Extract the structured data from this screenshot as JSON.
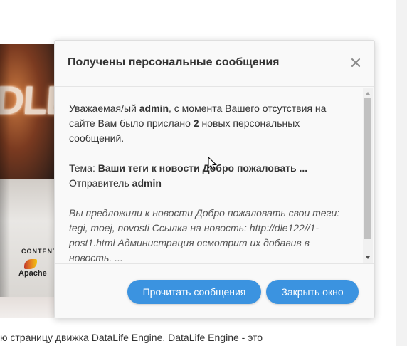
{
  "background": {
    "page_text": "ю страницу движка DataLife Engine. DataLife Engine - это",
    "product_box": {
      "logo_text": "DLE",
      "content_label": "CONTENT",
      "apache_label": "Apache"
    }
  },
  "modal": {
    "title": "Получены персональные сообщения",
    "close_icon": "close-icon",
    "body": {
      "greeting_prefix": "Уважаемая/ый ",
      "username": "admin",
      "greeting_middle": ", с момента Вашего отсутствия на сайте Вам было прислано ",
      "count": "2",
      "greeting_suffix": " новых персональных сообщений.",
      "subject_label": "Тема: ",
      "subject_value": "Ваши теги к новости Добро пожаловать ...",
      "sender_label": "Отправитель ",
      "sender_value": "admin",
      "excerpt": "Вы предложили к новости Добро пожаловать свои теги: tegi, moej, novosti Ссылка на новость: http://dle122//1-post1.html Администрация осмотрит их добавив в новость. ..."
    },
    "buttons": {
      "read_label": "Прочитать сообщения",
      "close_label": "Закрыть окно"
    }
  },
  "colors": {
    "accent": "#3b93e0",
    "text": "#333333",
    "modal_bg": "#f9f9f9"
  }
}
